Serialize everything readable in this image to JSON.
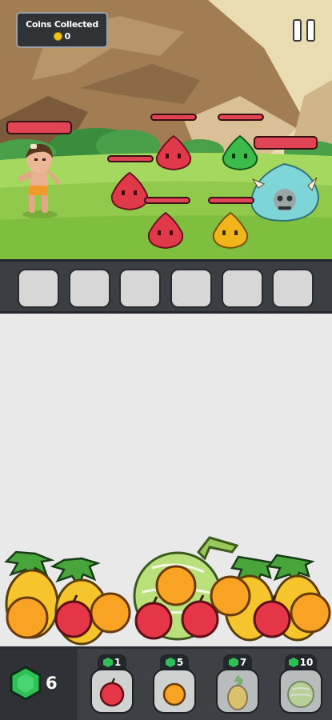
{
  "hud": {
    "coins_title": "Coins Collected",
    "coins_value": "0",
    "coin_icon": "coin-icon",
    "pause_icon": "pause-icon"
  },
  "battle": {
    "player": "caveman-hero",
    "enemies": [
      {
        "name": "red-slime",
        "color": "#e0394a"
      },
      {
        "name": "green-slime",
        "color": "#3bbb4a"
      },
      {
        "name": "red-slime",
        "color": "#e0394a"
      },
      {
        "name": "red-slime",
        "color": "#e0394a"
      },
      {
        "name": "yellow-slime",
        "color": "#f1b51c"
      },
      {
        "name": "skull-boss-slime",
        "color": "#7ed6df"
      }
    ]
  },
  "slots": {
    "count": 6
  },
  "wallet": {
    "gems": "6",
    "gem_icon": "gem-icon"
  },
  "shop": [
    {
      "fruit": "apple",
      "cost": "1",
      "locked": false
    },
    {
      "fruit": "orange",
      "cost": "5",
      "locked": false
    },
    {
      "fruit": "pineapple",
      "cost": "7",
      "locked": true
    },
    {
      "fruit": "melon",
      "cost": "10",
      "locked": true
    }
  ],
  "colors": {
    "accent_red": "#e04455",
    "gem_green": "#27a84a",
    "sky": "#e8d9b0",
    "grass": "#95d052"
  }
}
